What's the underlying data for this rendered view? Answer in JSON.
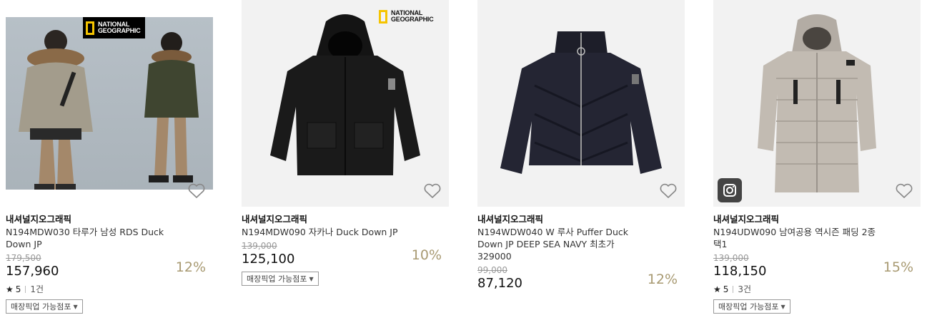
{
  "products": [
    {
      "brand": "내셔널지오그래픽",
      "name": "N194MDW030 타루가 남성 RDS Duck Down JP",
      "original_price": "179,500",
      "price": "157,960",
      "discount": "12%",
      "rating_star": "★",
      "rating": "5",
      "review_count": "1건",
      "pickup_label": "매장픽업 가능점포",
      "logo_text": "NATIONAL\nGEOGRAPHIC",
      "wish_icon": "heart-outline-icon"
    },
    {
      "brand": "내셔널지오그래픽",
      "name": "N194MDW090 자카나 Duck Down JP",
      "original_price": "139,000",
      "price": "125,100",
      "discount": "10%",
      "pickup_label": "매장픽업 가능점포",
      "logo_text": "NATIONAL\nGEOGRAPHIC",
      "wish_icon": "heart-outline-icon"
    },
    {
      "brand": "내셔널지오그래픽",
      "name": "N194WDW040 W 루사 Puffer Duck Down JP DEEP SEA NAVY 최초가 329000",
      "original_price": "99,000",
      "price": "87,120",
      "discount": "12%",
      "wish_icon": "heart-outline-icon"
    },
    {
      "brand": "내셔널지오그래픽",
      "name": "N194UDW090 남여공용 역시즌 패딩 2종 택1",
      "original_price": "139,000",
      "price": "118,150",
      "discount": "15%",
      "rating_star": "★",
      "rating": "5",
      "review_count": "3건",
      "pickup_label": "매장픽업 가능점포",
      "wish_icon": "heart-outline-icon",
      "badge_icon": "instagram-icon"
    }
  ],
  "colors": {
    "discount": "#a89a72",
    "logo_yellow": "#f5c400",
    "original_price": "#999999"
  }
}
